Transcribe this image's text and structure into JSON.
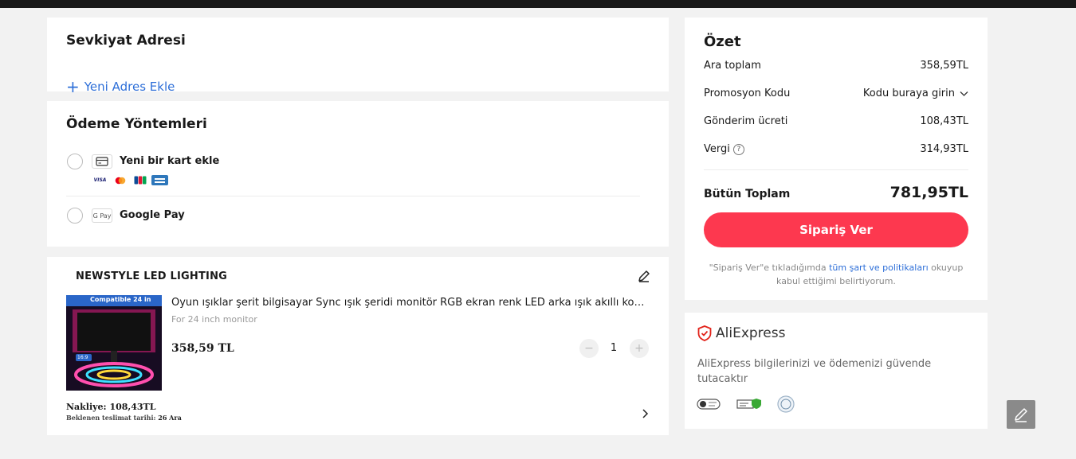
{
  "shipping": {
    "title": "Sevkiyat Adresi",
    "add_address": "Yeni Adres Ekle"
  },
  "payment": {
    "title": "Ödeme Yöntemleri",
    "methods": [
      {
        "label": "Yeni bir kart ekle",
        "icon": "credit-card-icon",
        "brands": [
          "VISA",
          "mastercard",
          "JCB",
          "AMEX"
        ]
      },
      {
        "label": "Google Pay",
        "icon": "google-pay-icon",
        "icon_text": "G Pay"
      }
    ]
  },
  "cart": {
    "seller": "NEWSTYLE LED LIGHTING",
    "item": {
      "title": "Oyun ışıklar şerit bilgisayar Sync ışık şeridi monitör RGB ekran renk LED arka ışık akıllı kontrol",
      "variant": "For 24 inch monitor",
      "price": "358,59 TL",
      "quantity": "1",
      "thumb_caption": "Compatible 24 in",
      "thumb_ratio": "16:9"
    },
    "shipping_label": "Nakliye: 108,43TL",
    "delivery_prefix": "Beklenen teslimat tarihi: ",
    "delivery_date": "26 Ara"
  },
  "summary": {
    "title": "Özet",
    "subtotal_label": "Ara toplam",
    "subtotal_value": "358,59TL",
    "promo_label": "Promosyon Kodu",
    "promo_value": "Kodu buraya girin",
    "shipping_label": "Gönderim ücreti",
    "shipping_value": "108,43TL",
    "tax_label": "Vergi",
    "tax_value": "314,93TL",
    "total_label": "Bütün Toplam",
    "total_value": "781,95TL",
    "order_button": "Sipariş Ver",
    "terms_prefix": "\"Sipariş Ver\"e tıkladığımda ",
    "terms_link": "tüm şart ve politikaları",
    "terms_suffix": " okuyup kabul ettiğimi belirtiyorum."
  },
  "trust": {
    "brand": "AliExpress",
    "text": "AliExpress bilgilerinizi ve ödemenizi güvende tutacaktır"
  },
  "colors": {
    "accent": "#fd384f",
    "link": "#2e6fd8",
    "background": "#f2f2f2"
  }
}
